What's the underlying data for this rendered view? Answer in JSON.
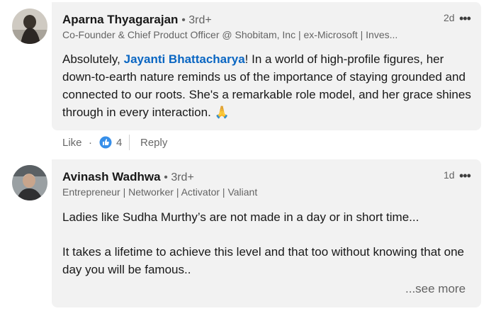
{
  "comments": [
    {
      "author": "Aparna Thyagarajan",
      "degree": "• 3rd+",
      "headline": "Co-Founder & Chief Product Officer @ Shobitam, Inc | ex-Microsoft | Inves...",
      "time": "2d",
      "body_pre": "Absolutely, ",
      "mention": "Jayanti Bhattacharya",
      "body_post": "! In a world of high-profile figures, her down-to-earth nature reminds us of the importance of staying grounded and connected to our roots. She's a remarkable role model, and her grace shines through in every interaction. 🙏",
      "actions": {
        "like_label": "Like",
        "separator": "·",
        "reaction_count": "4",
        "reply_label": "Reply"
      }
    },
    {
      "author": "Avinash Wadhwa",
      "degree": "• 3rd+",
      "headline": "Entrepreneur | Networker | Activator | Valiant",
      "time": "1d",
      "paragraph_1": "Ladies like Sudha Murthy’s are not made in a day or in short time...",
      "paragraph_2": "It takes a lifetime to achieve this level and that too without knowing that one day you will be famous..",
      "see_more": "...see more"
    }
  ],
  "icons": {
    "more": "more-horizontal-icon",
    "like_reaction": "thumbs-up-icon"
  },
  "colors": {
    "link": "#0a66c2",
    "bubble": "#f2f2f2",
    "like_reaction_bg": "#378fe9"
  }
}
